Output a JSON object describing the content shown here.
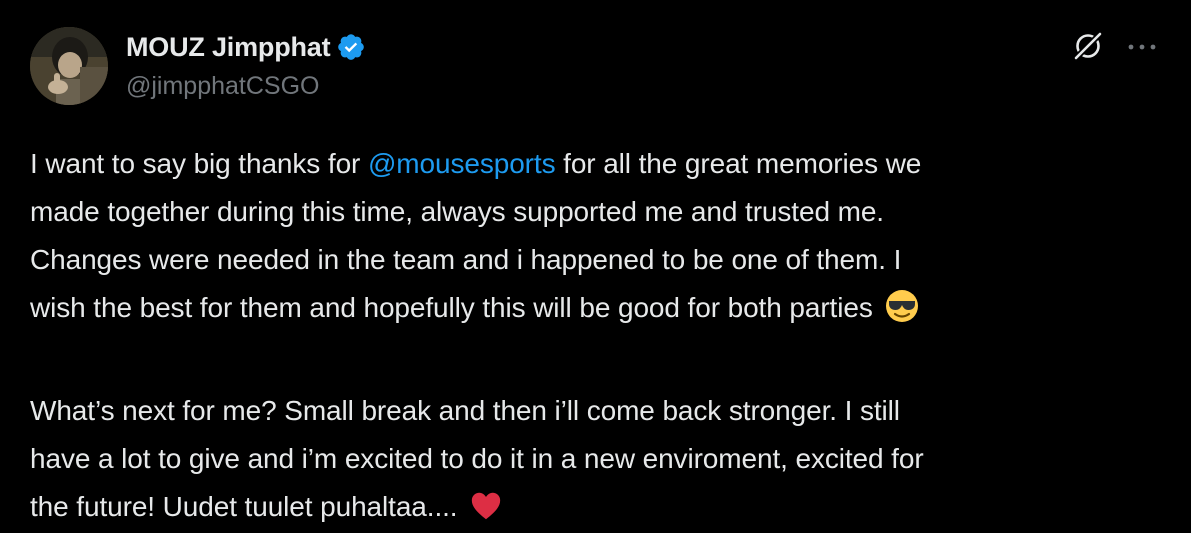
{
  "author": {
    "display_name": "MOUZ Jimpphat",
    "handle": "@jimpphatCSGO",
    "verified": true,
    "avatar_icon": "user-avatar"
  },
  "actions": {
    "grok_icon": "grok-icon",
    "more_icon": "more-dots-icon"
  },
  "tweet": {
    "p1_before": "I want to say big thanks for ",
    "mention": "@mousesports",
    "p1_after_line1": " for all the great memories we",
    "p1_line2": "made together during this time, always supported me and trusted me.",
    "p1_line3": "Changes were needed in the team and i happened to be one of them. I",
    "p1_line4": "wish the best for them and hopefully this will be good for both parties",
    "emoji1": "smiling-face-with-sunglasses",
    "p2_line1": "What’s next for me? Small break and then i’ll come back stronger. I still",
    "p2_line2": "have a lot to give and i’m excited to do it in a new enviroment, excited for",
    "p2_line3": "the future! Uudet tuulet puhaltaa....",
    "emoji2": "red-heart"
  },
  "colors": {
    "background": "#000000",
    "text": "#e7e9ea",
    "muted": "#71767b",
    "accent": "#1d9bf0"
  }
}
